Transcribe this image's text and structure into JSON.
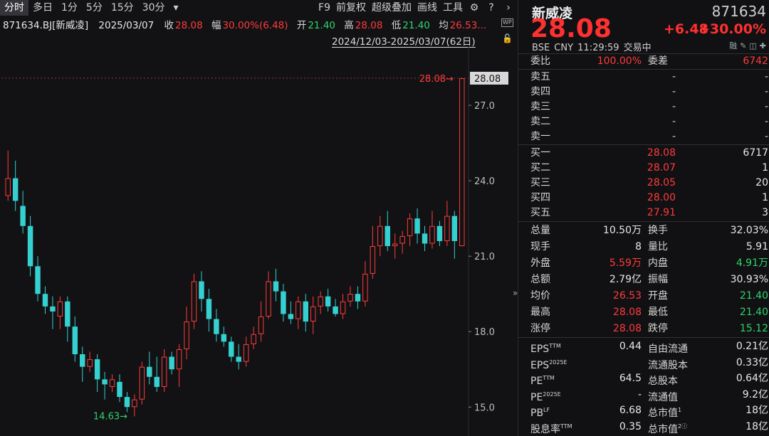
{
  "toolbar": {
    "left": [
      "分时",
      "多日",
      "1分",
      "5分",
      "15分",
      "30分",
      "▾"
    ],
    "right": [
      "F9",
      "前复权",
      "超级叠加",
      "画线",
      "工具"
    ],
    "active_index": 0
  },
  "info": {
    "code_name": "871634.BJ[新威凌]",
    "date": "2025/03/07",
    "close_label": "收",
    "close": "28.08",
    "amp_label": "幅",
    "amp": "30.00%(6.48)",
    "open_label": "开",
    "open": "21.40",
    "high_label": "高",
    "high": "28.08",
    "low_label": "低",
    "low": "21.40",
    "avg_label": "均",
    "avg": "26.53..."
  },
  "range_text": "2024/12/03-2025/03/07(62日)",
  "chart_data": {
    "type": "candlestick",
    "x_count": 62,
    "ylim": [
      14.3,
      28.7
    ],
    "yticks": [
      "27.0",
      "24.0",
      "21.0",
      "18.0",
      "15.0"
    ],
    "ytick_values": [
      27,
      24,
      21,
      18,
      15
    ],
    "last_price_label": "28.08",
    "high_annotation": "28.08",
    "low_annotation": "14.63",
    "candles": [
      [
        23.4,
        24.1,
        25.2,
        23.2
      ],
      [
        24.1,
        23.2,
        24.8,
        22.8
      ],
      [
        23.0,
        22.2,
        23.6,
        21.9
      ],
      [
        22.2,
        20.6,
        22.6,
        20.2
      ],
      [
        20.6,
        19.5,
        21.0,
        19.2
      ],
      [
        19.5,
        19.0,
        19.8,
        18.7
      ],
      [
        19.0,
        18.8,
        19.4,
        18.1
      ],
      [
        18.6,
        19.2,
        19.4,
        18.1
      ],
      [
        19.2,
        18.2,
        19.4,
        17.6
      ],
      [
        18.2,
        17.1,
        18.6,
        16.8
      ],
      [
        17.1,
        16.6,
        17.4,
        16.0
      ],
      [
        16.6,
        16.9,
        17.2,
        16.4
      ],
      [
        16.9,
        16.1,
        17.1,
        15.6
      ],
      [
        16.1,
        15.9,
        16.4,
        15.3
      ],
      [
        15.8,
        16.1,
        16.3,
        15.6
      ],
      [
        16.0,
        15.4,
        16.3,
        15.2
      ],
      [
        15.4,
        15.0,
        15.6,
        14.8
      ],
      [
        15.0,
        15.3,
        15.5,
        14.63
      ],
      [
        15.3,
        16.6,
        16.8,
        15.1
      ],
      [
        16.6,
        16.2,
        17.2,
        15.9
      ],
      [
        16.2,
        15.8,
        17.0,
        15.6
      ],
      [
        15.8,
        17.0,
        17.3,
        15.6
      ],
      [
        17.0,
        16.5,
        17.2,
        16.3
      ],
      [
        16.5,
        17.3,
        17.5,
        15.8
      ],
      [
        17.3,
        18.4,
        19.0,
        16.9
      ],
      [
        18.4,
        20.0,
        20.3,
        18.1
      ],
      [
        20.0,
        19.3,
        20.4,
        18.8
      ],
      [
        19.3,
        18.5,
        19.7,
        18.0
      ],
      [
        18.5,
        17.9,
        18.9,
        17.6
      ],
      [
        17.9,
        17.6,
        18.2,
        17.4
      ],
      [
        17.6,
        17.0,
        17.8,
        16.8
      ],
      [
        17.0,
        16.8,
        17.5,
        16.5
      ],
      [
        16.8,
        17.5,
        17.8,
        16.6
      ],
      [
        17.5,
        17.9,
        18.2,
        17.3
      ],
      [
        17.9,
        18.6,
        19.2,
        17.6
      ],
      [
        18.6,
        20.0,
        20.4,
        18.5
      ],
      [
        20.0,
        19.6,
        20.5,
        19.2
      ],
      [
        19.6,
        18.7,
        19.9,
        18.4
      ],
      [
        18.7,
        18.5,
        19.2,
        18.3
      ],
      [
        18.5,
        19.2,
        19.4,
        18.1
      ],
      [
        19.2,
        18.4,
        19.5,
        18.0
      ],
      [
        18.4,
        19.0,
        19.4,
        17.9
      ],
      [
        19.0,
        19.4,
        19.6,
        18.7
      ],
      [
        19.4,
        19.0,
        19.7,
        18.8
      ],
      [
        19.0,
        18.7,
        19.3,
        18.6
      ],
      [
        18.7,
        19.2,
        19.5,
        18.5
      ],
      [
        19.2,
        19.5,
        19.8,
        19.0
      ],
      [
        19.5,
        19.2,
        19.8,
        18.9
      ],
      [
        19.2,
        20.3,
        20.8,
        19.0
      ],
      [
        20.3,
        21.4,
        22.2,
        20.1
      ],
      [
        21.4,
        22.2,
        22.6,
        21.0
      ],
      [
        22.2,
        21.4,
        22.8,
        21.2
      ],
      [
        21.4,
        21.5,
        21.9,
        20.9
      ],
      [
        21.5,
        21.8,
        22.0,
        21.1
      ],
      [
        21.8,
        22.5,
        22.7,
        21.4
      ],
      [
        22.5,
        21.9,
        22.9,
        21.5
      ],
      [
        21.9,
        21.5,
        22.2,
        21.2
      ],
      [
        21.5,
        22.2,
        22.8,
        21.3
      ],
      [
        22.2,
        21.6,
        22.4,
        21.4
      ],
      [
        21.6,
        22.6,
        23.2,
        21.4
      ],
      [
        22.6,
        21.6,
        22.8,
        20.9
      ],
      [
        21.4,
        28.08,
        28.08,
        21.4
      ]
    ]
  },
  "quote": {
    "name": "新威凌",
    "code": "871634",
    "price": "28.08",
    "change": "+6.48",
    "change_pct": "+30.00%",
    "meta": "BSE  CNY  11:29:59  交易中",
    "header_icons": [
      "融",
      "✎",
      "◫",
      "✚"
    ],
    "wei": {
      "l1": "委比",
      "v1": "100.00%",
      "l2": "委差",
      "v2": "6742"
    },
    "sells": [
      {
        "label": "卖五",
        "price": "-",
        "vol": "-"
      },
      {
        "label": "卖四",
        "price": "-",
        "vol": "-"
      },
      {
        "label": "卖三",
        "price": "-",
        "vol": "-"
      },
      {
        "label": "卖二",
        "price": "-",
        "vol": "-"
      },
      {
        "label": "卖一",
        "price": "-",
        "vol": "-"
      }
    ],
    "buys": [
      {
        "label": "买一",
        "price": "28.08",
        "vol": "6717"
      },
      {
        "label": "买二",
        "price": "28.07",
        "vol": "1"
      },
      {
        "label": "买三",
        "price": "28.05",
        "vol": "20"
      },
      {
        "label": "买四",
        "price": "28.00",
        "vol": "1"
      },
      {
        "label": "买五",
        "price": "27.91",
        "vol": "3"
      }
    ],
    "stats": [
      {
        "l1": "总量",
        "v1": "10.50万",
        "c1": "wh",
        "l2": "换手",
        "v2": "32.03%",
        "c2": "wh"
      },
      {
        "l1": "现手",
        "v1": "8",
        "c1": "wh",
        "l2": "量比",
        "v2": "5.91",
        "c2": "wh"
      },
      {
        "l1": "外盘",
        "v1": "5.59万",
        "c1": "red",
        "l2": "内盘",
        "v2": "4.91万",
        "c2": "green"
      },
      {
        "l1": "总额",
        "v1": "2.79亿",
        "c1": "wh",
        "l2": "振幅",
        "v2": "30.93%",
        "c2": "wh"
      },
      {
        "l1": "均价",
        "v1": "26.53",
        "c1": "red",
        "l2": "开盘",
        "v2": "21.40",
        "c2": "green"
      },
      {
        "l1": "最高",
        "v1": "28.08",
        "c1": "red",
        "l2": "最低",
        "v2": "21.40",
        "c2": "green"
      },
      {
        "l1": "涨停",
        "v1": "28.08",
        "c1": "red",
        "l2": "跌停",
        "v2": "15.12",
        "c2": "green"
      }
    ],
    "fund": [
      {
        "l1": "EPS",
        "s1": "TTM",
        "v1": "0.44",
        "l2": "自由流通",
        "s2": "",
        "v2": "0.21亿"
      },
      {
        "l1": "EPS",
        "s1": "2025E",
        "v1": "",
        "l2": "流通股本",
        "s2": "",
        "v2": "0.33亿"
      },
      {
        "l1": "PE",
        "s1": "TTM",
        "v1": "64.5",
        "l2": "总股本",
        "s2": "",
        "v2": "0.64亿"
      },
      {
        "l1": "PE",
        "s1": "2025E",
        "v1": "-",
        "l2": "流通值",
        "s2": "",
        "v2": "9.2亿"
      },
      {
        "l1": "PB",
        "s1": "LF",
        "v1": "6.68",
        "l2": "总市值",
        "s2": "1",
        "v2": "18亿"
      },
      {
        "l1": "股息率",
        "s1": "TTM",
        "v1": "0.35",
        "l2": "总市值",
        "s2": "2ⓘ",
        "v2": "18亿"
      }
    ]
  }
}
